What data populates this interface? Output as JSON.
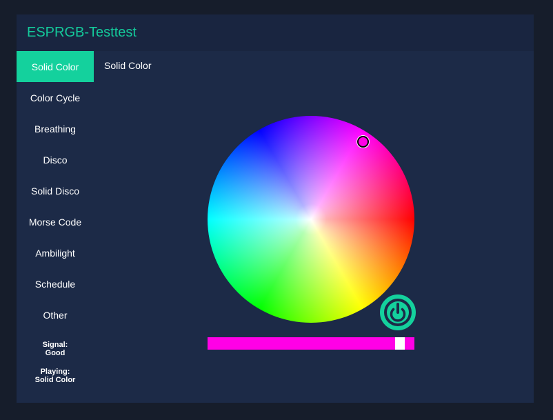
{
  "app": {
    "title": "ESPRGB-Testtest"
  },
  "sidebar": {
    "items": [
      {
        "label": "Solid Color",
        "active": true
      },
      {
        "label": "Color Cycle"
      },
      {
        "label": "Breathing"
      },
      {
        "label": "Disco"
      },
      {
        "label": "Solid Disco"
      },
      {
        "label": "Morse Code"
      },
      {
        "label": "Ambilight"
      },
      {
        "label": "Schedule"
      },
      {
        "label": "Other"
      }
    ]
  },
  "status": {
    "signal_label": "Signal:",
    "signal_value": "Good",
    "playing_label": "Playing:",
    "playing_value": "Solid Color"
  },
  "main": {
    "mode_title": "Solid Color",
    "selected_color": "#ff00e6",
    "brightness": 0.95,
    "power_icon": "power-icon"
  },
  "colors": {
    "background": "#161d2b",
    "panel": "#1c2a47",
    "header": "#192540",
    "accent": "#14d19d",
    "title": "#14c99a"
  }
}
